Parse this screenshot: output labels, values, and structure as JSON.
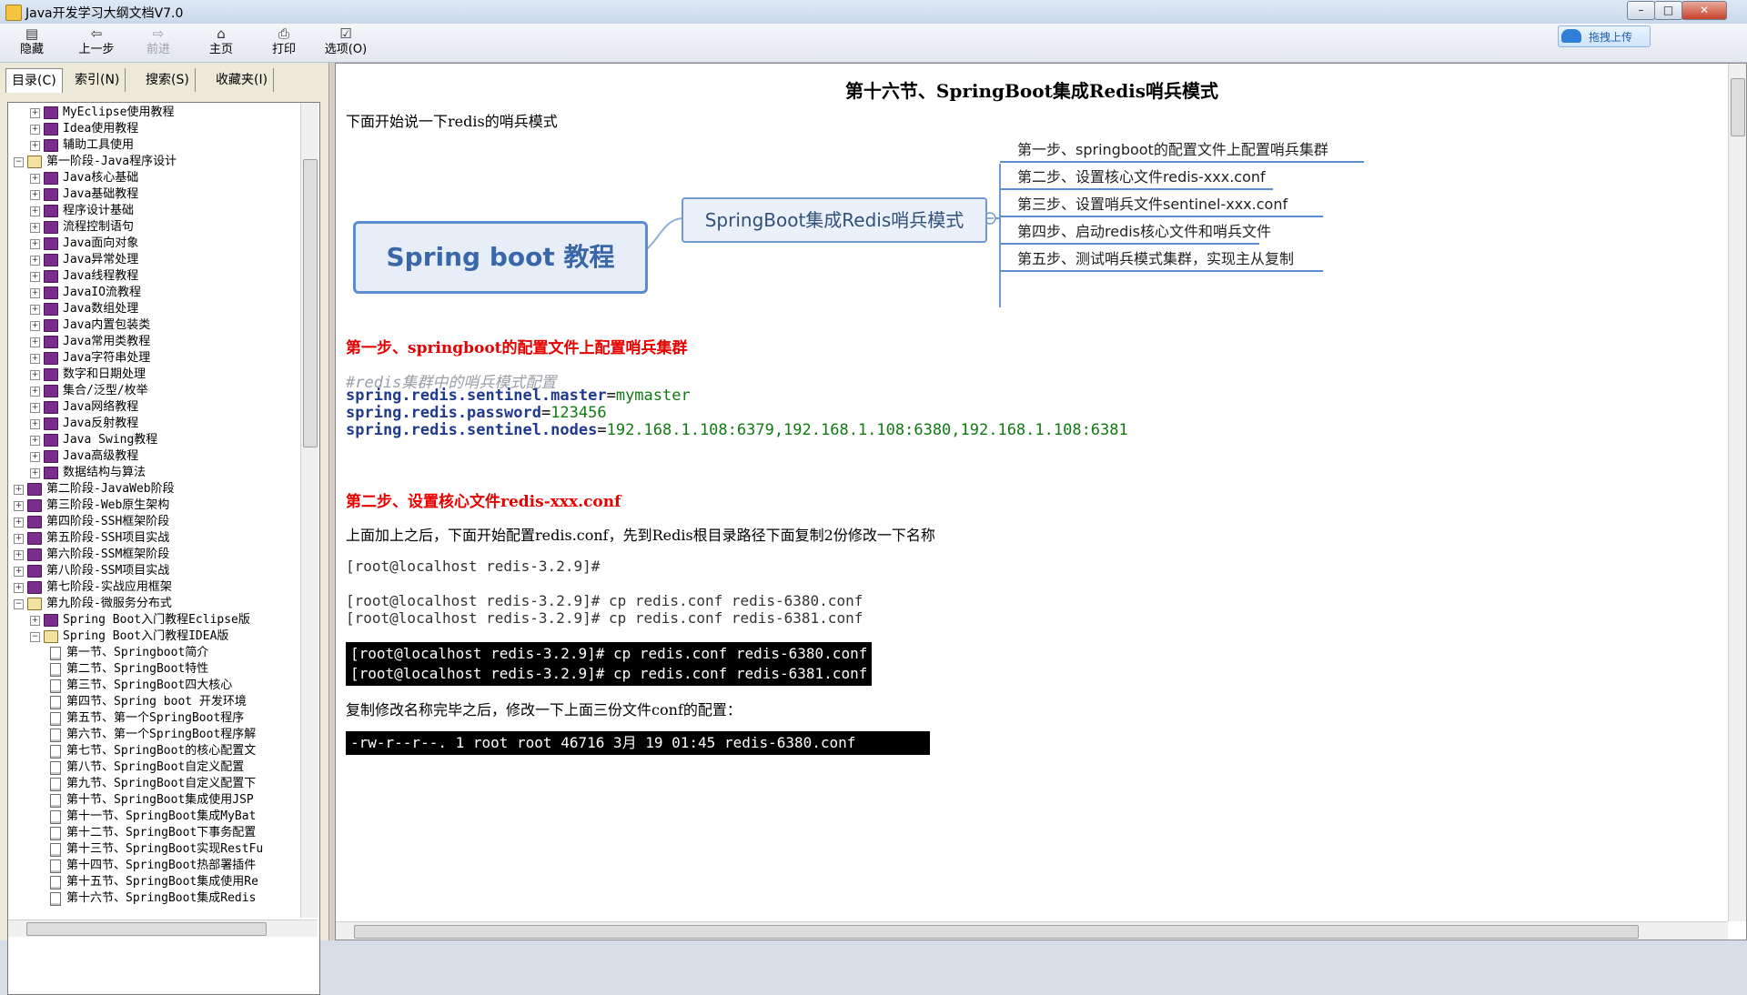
{
  "window": {
    "title": "Java开发学习大纲文档V7.0",
    "min": "–",
    "max": "□",
    "close": "✕"
  },
  "upload": {
    "label": "拖拽上传"
  },
  "toolbar": [
    {
      "name": "hide-button",
      "icon": "▤",
      "label": "隐藏",
      "disabled": false
    },
    {
      "name": "back-button",
      "icon": "⇦",
      "label": "上一步",
      "disabled": false
    },
    {
      "name": "forward-button",
      "icon": "⇨",
      "label": "前进",
      "disabled": true
    },
    {
      "name": "home-button",
      "icon": "⌂",
      "label": "主页",
      "disabled": false
    },
    {
      "name": "print-button",
      "icon": "⎙",
      "label": "打印",
      "disabled": false
    },
    {
      "name": "options-button",
      "icon": "☑",
      "label": "选项(O)",
      "disabled": false
    }
  ],
  "tabs": [
    "目录(C)",
    "索引(N)",
    "搜索(S)",
    "收藏夹(I)"
  ],
  "tree": [
    {
      "level": 1,
      "toggle": "+",
      "icon": "book",
      "label": "MyEclipse使用教程"
    },
    {
      "level": 1,
      "toggle": "+",
      "icon": "book",
      "label": "Idea使用教程"
    },
    {
      "level": 1,
      "toggle": "+",
      "icon": "book",
      "label": "辅助工具使用"
    },
    {
      "level": 0,
      "toggle": "-",
      "icon": "open",
      "label": "第一阶段-Java程序设计"
    },
    {
      "level": 1,
      "toggle": "+",
      "icon": "book",
      "label": "Java核心基础"
    },
    {
      "level": 1,
      "toggle": "+",
      "icon": "book",
      "label": "Java基础教程"
    },
    {
      "level": 1,
      "toggle": "+",
      "icon": "book",
      "label": "程序设计基础"
    },
    {
      "level": 1,
      "toggle": "+",
      "icon": "book",
      "label": "流程控制语句"
    },
    {
      "level": 1,
      "toggle": "+",
      "icon": "book",
      "label": "Java面向对象"
    },
    {
      "level": 1,
      "toggle": "+",
      "icon": "book",
      "label": "Java异常处理"
    },
    {
      "level": 1,
      "toggle": "+",
      "icon": "book",
      "label": "Java线程教程"
    },
    {
      "level": 1,
      "toggle": "+",
      "icon": "book",
      "label": "JavaIO流教程"
    },
    {
      "level": 1,
      "toggle": "+",
      "icon": "book",
      "label": "Java数组处理"
    },
    {
      "level": 1,
      "toggle": "+",
      "icon": "book",
      "label": "Java内置包装类"
    },
    {
      "level": 1,
      "toggle": "+",
      "icon": "book",
      "label": "Java常用类教程"
    },
    {
      "level": 1,
      "toggle": "+",
      "icon": "book",
      "label": "Java字符串处理"
    },
    {
      "level": 1,
      "toggle": "+",
      "icon": "book",
      "label": "数字和日期处理"
    },
    {
      "level": 1,
      "toggle": "+",
      "icon": "book",
      "label": "集合/泛型/枚举"
    },
    {
      "level": 1,
      "toggle": "+",
      "icon": "book",
      "label": "Java网络教程"
    },
    {
      "level": 1,
      "toggle": "+",
      "icon": "book",
      "label": "Java反射教程"
    },
    {
      "level": 1,
      "toggle": "+",
      "icon": "book",
      "label": "Java Swing教程"
    },
    {
      "level": 1,
      "toggle": "+",
      "icon": "book",
      "label": "Java高级教程"
    },
    {
      "level": 1,
      "toggle": "+",
      "icon": "book",
      "label": "数据结构与算法"
    },
    {
      "level": 0,
      "toggle": "+",
      "icon": "book",
      "label": "第二阶段-JavaWeb阶段"
    },
    {
      "level": 0,
      "toggle": "+",
      "icon": "book",
      "label": "第三阶段-Web原生架构"
    },
    {
      "level": 0,
      "toggle": "+",
      "icon": "book",
      "label": "第四阶段-SSH框架阶段"
    },
    {
      "level": 0,
      "toggle": "+",
      "icon": "book",
      "label": "第五阶段-SSH项目实战"
    },
    {
      "level": 0,
      "toggle": "+",
      "icon": "book",
      "label": "第六阶段-SSM框架阶段"
    },
    {
      "level": 0,
      "toggle": "+",
      "icon": "book",
      "label": "第八阶段-SSM项目实战"
    },
    {
      "level": 0,
      "toggle": "+",
      "icon": "book",
      "label": "第七阶段-实战应用框架"
    },
    {
      "level": 0,
      "toggle": "-",
      "icon": "open",
      "label": "第九阶段-微服务分布式"
    },
    {
      "level": 1,
      "toggle": "+",
      "icon": "book",
      "label": "Spring Boot入门教程Eclipse版"
    },
    {
      "level": 1,
      "toggle": "-",
      "icon": "open",
      "label": "Spring Boot入门教程IDEA版"
    },
    {
      "level": 2,
      "toggle": "",
      "icon": "page",
      "label": "第一节、Springboot简介"
    },
    {
      "level": 2,
      "toggle": "",
      "icon": "page",
      "label": "第二节、SpringBoot特性"
    },
    {
      "level": 2,
      "toggle": "",
      "icon": "page",
      "label": "第三节、SpringBoot四大核心"
    },
    {
      "level": 2,
      "toggle": "",
      "icon": "page",
      "label": "第四节、Spring boot 开发环境"
    },
    {
      "level": 2,
      "toggle": "",
      "icon": "page",
      "label": "第五节、第一个SpringBoot程序"
    },
    {
      "level": 2,
      "toggle": "",
      "icon": "page",
      "label": "第六节、第一个SpringBoot程序解"
    },
    {
      "level": 2,
      "toggle": "",
      "icon": "page",
      "label": "第七节、SpringBoot的核心配置文"
    },
    {
      "level": 2,
      "toggle": "",
      "icon": "page",
      "label": "第八节、SpringBoot自定义配置"
    },
    {
      "level": 2,
      "toggle": "",
      "icon": "page",
      "label": "第九节、SpringBoot自定义配置下"
    },
    {
      "level": 2,
      "toggle": "",
      "icon": "page",
      "label": "第十节、SpringBoot集成使用JSP"
    },
    {
      "level": 2,
      "toggle": "",
      "icon": "page",
      "label": "第十一节、SpringBoot集成MyBat"
    },
    {
      "level": 2,
      "toggle": "",
      "icon": "page",
      "label": "第十二节、SpringBoot下事务配置"
    },
    {
      "level": 2,
      "toggle": "",
      "icon": "page",
      "label": "第十三节、SpringBoot实现RestFu"
    },
    {
      "level": 2,
      "toggle": "",
      "icon": "page",
      "label": "第十四节、SpringBoot热部署插件"
    },
    {
      "level": 2,
      "toggle": "",
      "icon": "page",
      "label": "第十五节、SpringBoot集成使用Re"
    },
    {
      "level": 2,
      "toggle": "",
      "icon": "page",
      "label": "第十六节、SpringBoot集成Redis"
    }
  ],
  "content": {
    "title": "第十六节、SpringBoot集成Redis哨兵模式",
    "intro": "下面开始说一下redis的哨兵模式",
    "mindmap": {
      "root": "Spring boot 教程",
      "center": "SpringBoot集成Redis哨兵模式",
      "leaves": [
        "第一步、springboot的配置文件上配置哨兵集群",
        "第二步、设置核心文件redis-xxx.conf",
        "第三步、设置哨兵文件sentinel-xxx.conf",
        "第四步、启动redis核心文件和哨兵文件",
        "第五步、测试哨兵模式集群，实现主从复制"
      ]
    },
    "step1_heading": "第一步、springboot的配置文件上配置哨兵集群",
    "config_comment": "#redis集群中的哨兵模式配置",
    "config": [
      {
        "key": "spring.redis.sentinel.master",
        "value": "mymaster"
      },
      {
        "key": "spring.redis.password",
        "value": "123456"
      },
      {
        "key": "spring.redis.sentinel.nodes",
        "value": "192.168.1.108:6379,192.168.1.108:6380,192.168.1.108:6381"
      }
    ],
    "step2_heading": "第二步、设置核心文件redis-xxx.conf",
    "step2_text": "上面加上之后，下面开始配置redis.conf，先到Redis根目录路径下面复制2份修改一下名称",
    "prompt1": "[root@localhost redis-3.2.9]#",
    "cmd1": "[root@localhost redis-3.2.9]# cp redis.conf redis-6380.conf",
    "cmd2": "[root@localhost redis-3.2.9]# cp redis.conf redis-6381.conf",
    "terminal1": [
      "[root@localhost redis-3.2.9]# cp redis.conf redis-6380.conf",
      "[root@localhost redis-3.2.9]# cp redis.conf redis-6381.conf"
    ],
    "step2_text2": "复制修改名称完毕之后，修改一下上面三份文件conf的配置：",
    "terminal2": "-rw-r--r--.  1 root root 46716 3月   19 01:45 redis-6380.conf"
  }
}
